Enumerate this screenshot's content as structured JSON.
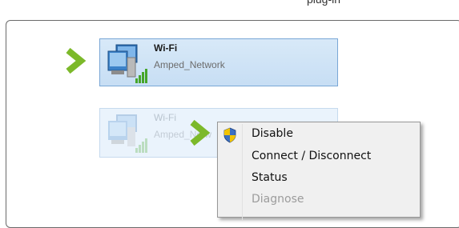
{
  "top_text": "plug-in",
  "adapters": [
    {
      "name": "Wi-Fi",
      "network": "Amped_Network",
      "selected": true
    },
    {
      "name": "Wi-Fi",
      "network": "Amped_Netw",
      "selected": false
    }
  ],
  "context_menu": {
    "items": [
      {
        "label": "Disable",
        "icon": "uac-shield-icon"
      },
      {
        "label": "Connect / Disconnect"
      },
      {
        "label": "Status"
      },
      {
        "label": "Diagnose"
      }
    ]
  },
  "colors": {
    "chevron": "#7cb92a",
    "selection_bg": "#cfe3f6",
    "selection_border": "#7aa7d6",
    "menu_bg": "#f0f0f0"
  },
  "icons": [
    "chevron-right-icon",
    "network-adapter-icon",
    "signal-bars-icon",
    "uac-shield-icon"
  ]
}
